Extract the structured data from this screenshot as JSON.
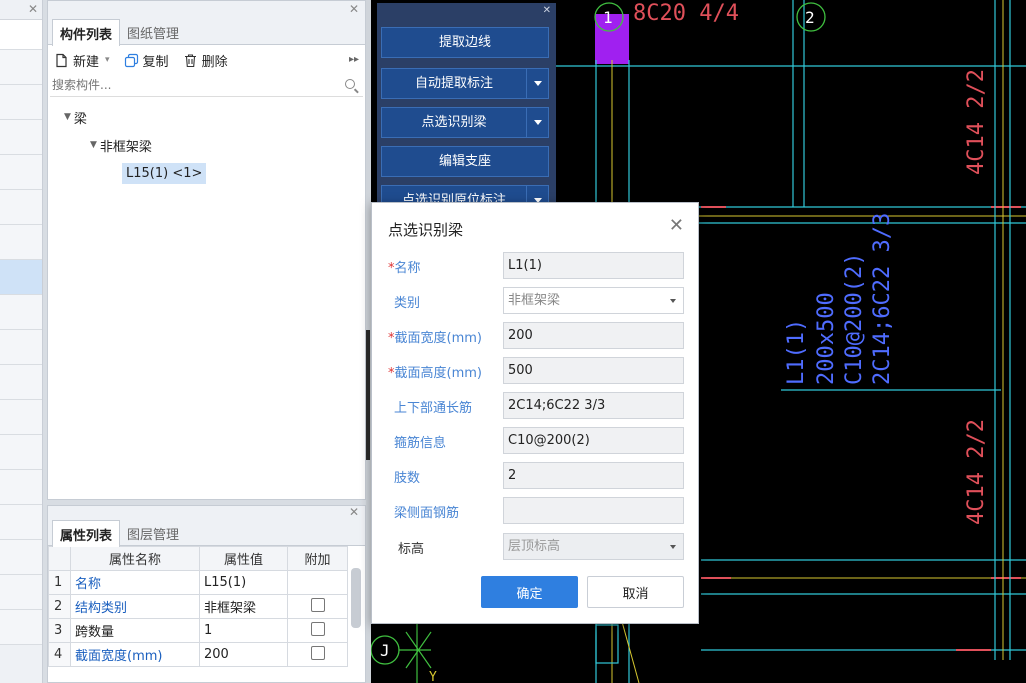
{
  "colors": {
    "accent": "#2f7fe0",
    "selected": "#cfe2f7",
    "tool_panel": "#2b3f66",
    "cad_background": "#000000",
    "cad_text_red": "#e0505a",
    "cad_text_blue": "#4f6cff",
    "cad_cyan": "#31c8d8",
    "cad_yellow": "#d8c830",
    "cad_magenta": "#a020f0",
    "cad_green": "#40c040"
  },
  "component_panel": {
    "tabs": [
      "构件列表",
      "图纸管理"
    ],
    "toolbar": {
      "new_label": "新建",
      "copy_label": "复制",
      "delete_label": "删除"
    },
    "search_placeholder": "搜索构件...",
    "tree": {
      "root": "梁",
      "child": "非框架梁",
      "leaf": "L15(1) <1>"
    }
  },
  "property_panel": {
    "tabs": [
      "属性列表",
      "图层管理"
    ],
    "headers": [
      "属性名称",
      "属性值",
      "附加"
    ],
    "rows": [
      {
        "idx": "1",
        "name": "名称",
        "value": "L15(1)",
        "has_checkbox": false
      },
      {
        "idx": "2",
        "name": "结构类别",
        "value": "非框架梁",
        "has_checkbox": true
      },
      {
        "idx": "3",
        "name": "跨数量",
        "value": "1",
        "has_checkbox": true
      },
      {
        "idx": "4",
        "name": "截面宽度(mm)",
        "value": "200",
        "has_checkbox": true
      }
    ]
  },
  "tool_panel": {
    "buttons": [
      "提取边线",
      "自动提取标注",
      "点选识别梁",
      "编辑支座",
      "点选识别原位标注"
    ]
  },
  "dialog": {
    "title": "点选识别梁",
    "fields": {
      "name": {
        "label": "名称",
        "value": "L1(1)",
        "required": true
      },
      "category": {
        "label": "类别",
        "value": "非框架梁",
        "required": false
      },
      "width": {
        "label": "截面宽度(mm)",
        "value": "200",
        "required": true
      },
      "height": {
        "label": "截面高度(mm)",
        "value": "500",
        "required": true
      },
      "through_bars": {
        "label": "上下部通长筋",
        "value": "2C14;6C22 3/3",
        "required": false
      },
      "stirrup": {
        "label": "箍筋信息",
        "value": "C10@200(2)",
        "required": false
      },
      "legs": {
        "label": "肢数",
        "value": "2",
        "required": false
      },
      "side_bars": {
        "label": "梁侧面钢筋",
        "value": "",
        "required": false
      },
      "elevation": {
        "label": "标高",
        "value": "层顶标高",
        "required": false
      }
    },
    "ok_label": "确定",
    "cancel_label": "取消"
  },
  "cad": {
    "axis_1": "1",
    "axis_2": "2",
    "axis_j": "J",
    "axis_y": "Y",
    "top_note": "8C20 4/4",
    "right_note_top": "4C14 2/2",
    "right_note_bottom": "4C14 2/2",
    "beam_label_1": "L1(1)",
    "beam_label_2": "200x500",
    "beam_label_3": "C10@200(2)",
    "beam_label_4": "2C14;6C22 3/3"
  }
}
